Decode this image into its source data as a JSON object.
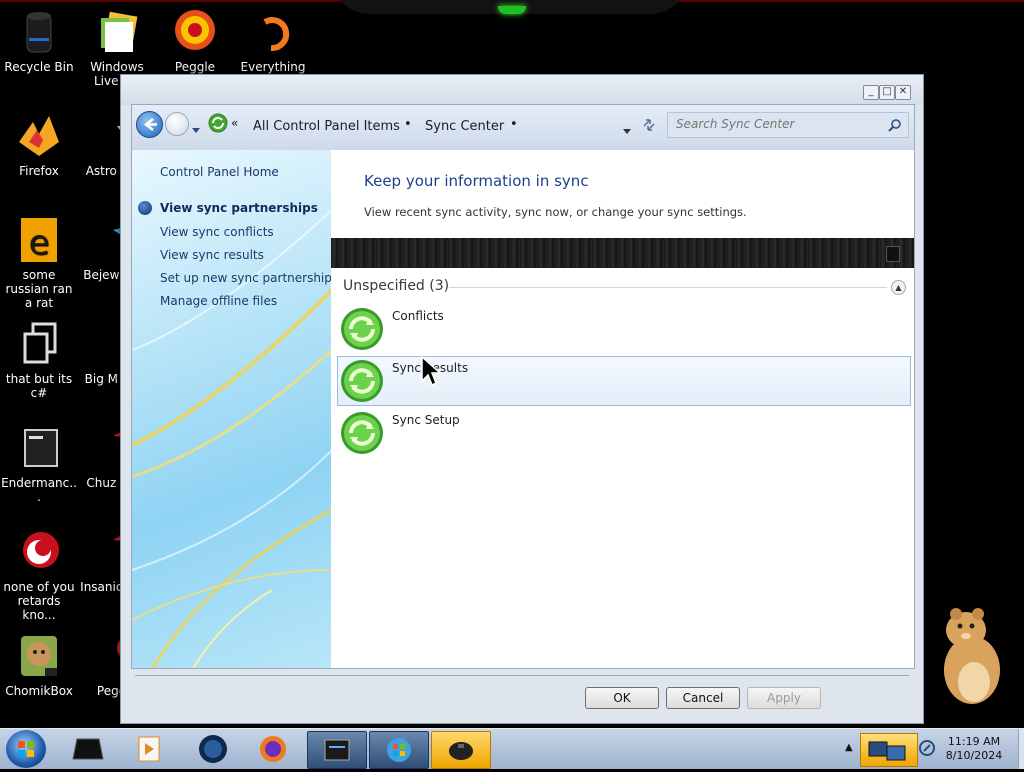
{
  "desktop": {
    "icons": [
      {
        "label": "Recycle Bin",
        "icon": "recycle-bin-icon"
      },
      {
        "label": "Windows Live Ma",
        "icon": "windows-live-mail-icon"
      },
      {
        "label": "Peggle World",
        "icon": "peggle-world-icon"
      },
      {
        "label": "Everything",
        "icon": "everything-icon"
      },
      {
        "label": "Firefox",
        "icon": "firefox-icon"
      },
      {
        "label": "Astro Delu",
        "icon": "astro-icon"
      },
      {
        "label": "some russian ran a rat",
        "icon": "file-e-icon"
      },
      {
        "label": "Bejew Delu",
        "icon": "bejeweled-icon"
      },
      {
        "label": "that but its c#",
        "icon": "app-icon"
      },
      {
        "label": "Big M Delu",
        "icon": "game-icon"
      },
      {
        "label": "Endermanc...",
        "icon": "terminal-icon"
      },
      {
        "label": "Chuz Delu",
        "icon": "game-icon"
      },
      {
        "label": "none of you retards kno...",
        "icon": "app-icon"
      },
      {
        "label": "Insanic Delu",
        "icon": "game-icon"
      },
      {
        "label": "ChomikBox",
        "icon": "chomikbox-icon"
      },
      {
        "label": "Peggle",
        "icon": "peggle-icon"
      }
    ]
  },
  "window": {
    "nav": {
      "breadcrumb": [
        "All Control Panel Items",
        "Sync Center"
      ],
      "search_placeholder": "Search Sync Center"
    },
    "left_pane": {
      "home": "Control Panel Home",
      "links": [
        "View sync partnerships",
        "View sync conflicts",
        "View sync results",
        "Set up new sync partnerships",
        "Manage offline files"
      ]
    },
    "content": {
      "title": "Keep your information in sync",
      "subtitle": "View recent sync activity, sync now, or change your sync settings.",
      "group_label": "Unspecified (3)",
      "items": [
        "Conflicts",
        "Sync Results",
        "Sync Setup"
      ],
      "selected_item": "Sync Results"
    },
    "buttons": {
      "ok": "OK",
      "cancel": "Cancel",
      "apply": "Apply"
    }
  },
  "taskbar": {
    "clock": {
      "time": "11:19 AM",
      "date": "8/10/2024"
    },
    "active_button_index": 6
  }
}
